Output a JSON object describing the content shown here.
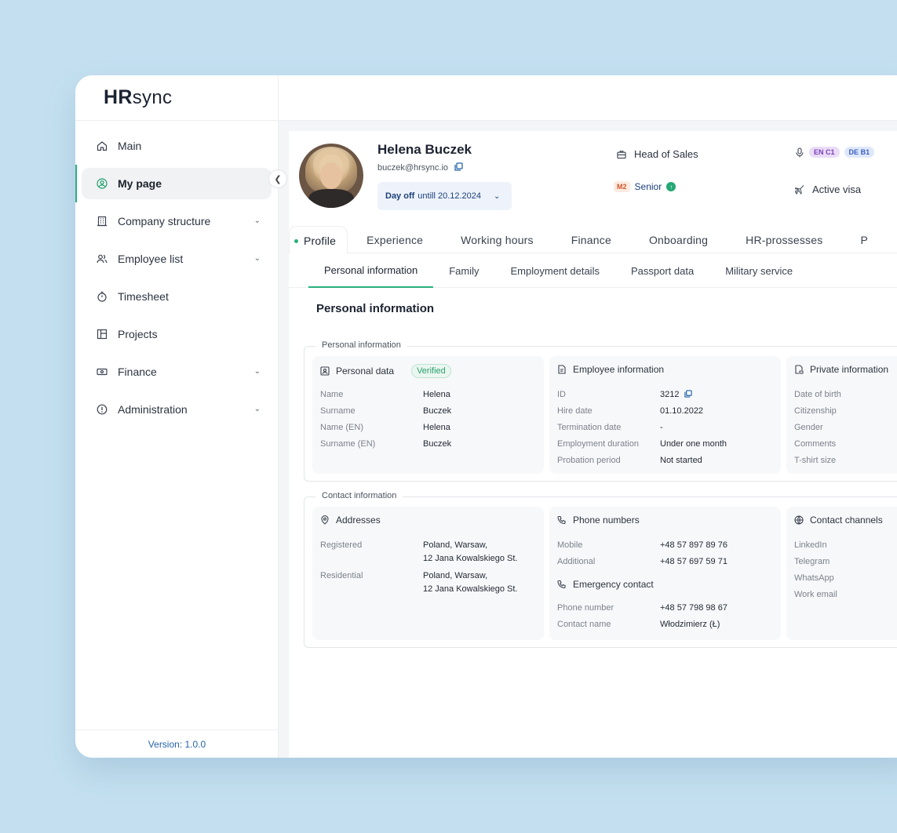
{
  "app": {
    "logo_main": "HR",
    "logo_sub": "sync",
    "version": "Version: 1.0.0"
  },
  "sidebar": {
    "items": [
      {
        "label": "Main",
        "icon": "home-icon",
        "expandable": false
      },
      {
        "label": "My page",
        "icon": "user-circle-icon",
        "expandable": false,
        "active": true
      },
      {
        "label": "Company structure",
        "icon": "building-icon",
        "expandable": true
      },
      {
        "label": "Employee list",
        "icon": "users-icon",
        "expandable": true
      },
      {
        "label": "Timesheet",
        "icon": "stopwatch-icon",
        "expandable": false
      },
      {
        "label": "Projects",
        "icon": "layout-icon",
        "expandable": false
      },
      {
        "label": "Finance",
        "icon": "money-icon",
        "expandable": true
      },
      {
        "label": "Administration",
        "icon": "info-icon",
        "expandable": true
      }
    ]
  },
  "profile": {
    "name": "Helena Buczek",
    "email": "buczek@hrsync.io",
    "dayoff_label": "Day off",
    "dayoff_value": "untill 20.12.2024",
    "role": "Head of Sales",
    "level_badge": "M2",
    "level": "Senior",
    "langs": [
      {
        "code": "EN",
        "level": "C1"
      },
      {
        "code": "DE",
        "level": "B1"
      }
    ],
    "visa": "Active visa"
  },
  "tabs": [
    "Profile",
    "Experience",
    "Working hours",
    "Finance",
    "Onboarding",
    "HR-prossesses",
    "P"
  ],
  "subtabs": [
    "Personal information",
    "Family",
    "Employment details",
    "Passport data",
    "Military service"
  ],
  "section_title": "Personal information",
  "personal_group": {
    "legend": "Personal information",
    "personal_data": {
      "title": "Personal data",
      "badge": "Verified",
      "rows": [
        {
          "k": "Name",
          "v": "Helena"
        },
        {
          "k": "Surname",
          "v": "Buczek"
        },
        {
          "k": "Name (EN)",
          "v": "Helena"
        },
        {
          "k": "Surname (EN)",
          "v": "Buczek"
        }
      ]
    },
    "employee_info": {
      "title": "Employee information",
      "rows": [
        {
          "k": "ID",
          "v": "3212"
        },
        {
          "k": "Hire date",
          "v": "01.10.2022"
        },
        {
          "k": "Termination date",
          "v": "-"
        },
        {
          "k": "Employment duration",
          "v": "Under one month"
        },
        {
          "k": "Probation period",
          "v": "Not started"
        }
      ]
    },
    "private_info": {
      "title": "Private information",
      "rows": [
        {
          "k": "Date of birth"
        },
        {
          "k": "Citizenship"
        },
        {
          "k": "Gender"
        },
        {
          "k": "Comments"
        },
        {
          "k": "T-shirt size"
        }
      ]
    }
  },
  "contact_group": {
    "legend": "Contact information",
    "addresses": {
      "title": "Addresses",
      "registered_k": "Registered",
      "registered_v1": "Poland, Warsaw,",
      "registered_v2": "12 Jana Kowalskiego St.",
      "residential_k": "Residential",
      "residential_v1": "Poland, Warsaw,",
      "residential_v2": "12 Jana Kowalskiego St."
    },
    "phones": {
      "title": "Phone numbers",
      "rows": [
        {
          "k": "Mobile",
          "v": "+48 57 897 89 76"
        },
        {
          "k": "Additional",
          "v": "+48 57 697 59 71"
        }
      ],
      "emergency_title": "Emergency contact",
      "emergency_rows": [
        {
          "k": "Phone number",
          "v": "+48 57 798 98 67"
        },
        {
          "k": "Contact name",
          "v": "Włodzimierz (Ł)"
        }
      ]
    },
    "channels": {
      "title": "Contact channels",
      "rows": [
        {
          "k": "LinkedIn"
        },
        {
          "k": "Telegram"
        },
        {
          "k": "WhatsApp"
        },
        {
          "k": "Work email"
        }
      ]
    }
  }
}
